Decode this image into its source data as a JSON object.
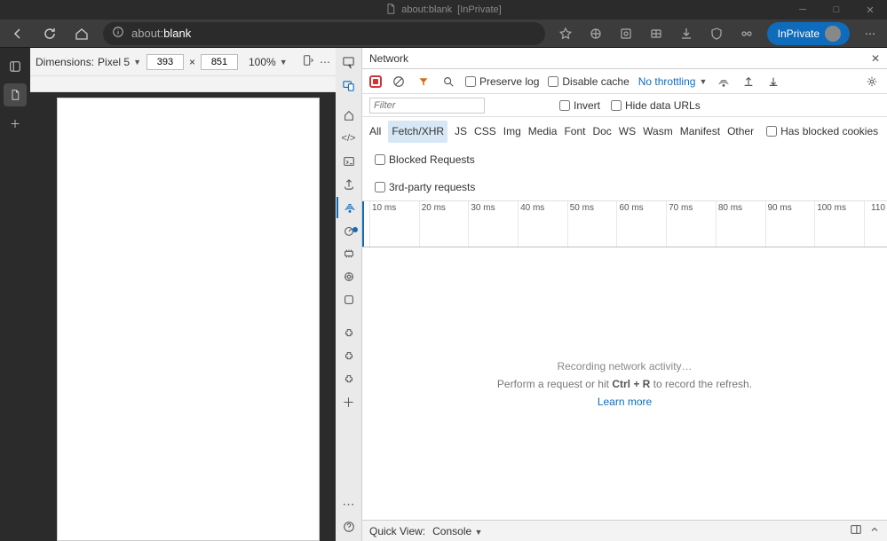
{
  "title": {
    "tab_name": "about:blank",
    "mode": "[InPrivate]"
  },
  "nav": {
    "url_prefix": "about:",
    "url_main": "blank",
    "inprivate_label": "InPrivate"
  },
  "device_toolbar": {
    "dimensions_label": "Dimensions:",
    "device_name": "Pixel 5",
    "width": "393",
    "sep": "×",
    "height": "851",
    "zoom": "100%"
  },
  "panel": {
    "title": "Network"
  },
  "net_toolbar": {
    "preserve_log": "Preserve log",
    "disable_cache": "Disable cache",
    "throttling": "No throttling"
  },
  "filter_row": {
    "filter_placeholder": "Filter",
    "invert": "Invert",
    "hide_data_urls": "Hide data URLs"
  },
  "types": {
    "all": "All",
    "fetch_xhr": "Fetch/XHR",
    "js": "JS",
    "css": "CSS",
    "img": "Img",
    "media": "Media",
    "font": "Font",
    "doc": "Doc",
    "ws": "WS",
    "wasm": "Wasm",
    "manifest": "Manifest",
    "other": "Other",
    "has_blocked_cookies": "Has blocked cookies",
    "blocked_requests": "Blocked Requests",
    "third_party": "3rd-party requests"
  },
  "ruler": {
    "t0": "10 ms",
    "t1": "20 ms",
    "t2": "30 ms",
    "t3": "40 ms",
    "t4": "50 ms",
    "t5": "60 ms",
    "t6": "70 ms",
    "t7": "80 ms",
    "t8": "90 ms",
    "t9": "100 ms",
    "t10": "110"
  },
  "empty": {
    "line1": "Recording network activity…",
    "line2a": "Perform a request or hit ",
    "kbd": "Ctrl + R",
    "line2b": " to record the refresh.",
    "learn_more": "Learn more"
  },
  "quickview": {
    "label": "Quick View:",
    "panel": "Console"
  }
}
